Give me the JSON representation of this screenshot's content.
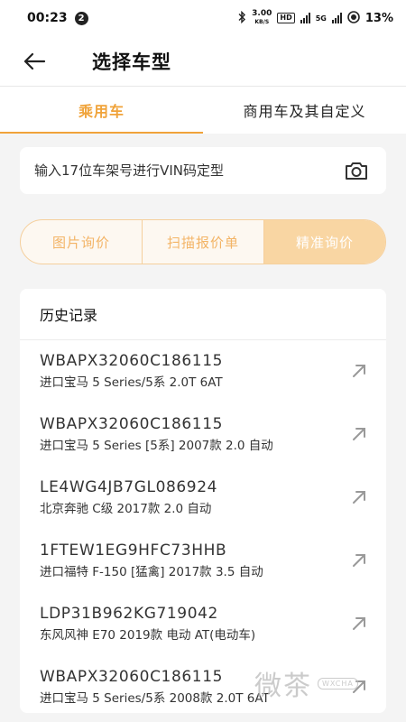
{
  "status_bar": {
    "time": "00:23",
    "notification_count": "2",
    "net_speed_value": "3.00",
    "net_speed_unit": "KB/S",
    "hd_label": "HD",
    "network_label": "5G",
    "battery_percent": "13%"
  },
  "header": {
    "title": "选择车型"
  },
  "tabs": [
    {
      "label": "乘用车",
      "active": true
    },
    {
      "label": "商用车及其自定义",
      "active": false
    }
  ],
  "vin_search": {
    "placeholder": "输入17位车架号进行VIN码定型",
    "value": ""
  },
  "modes": [
    {
      "label": "图片询价",
      "active": false
    },
    {
      "label": "扫描报价单",
      "active": false
    },
    {
      "label": "精准询价",
      "active": true
    }
  ],
  "history": {
    "title": "历史记录",
    "items": [
      {
        "vin": "WBAPX32060C186115",
        "model": "进口宝马 5 Series/5系 2.0T 6AT"
      },
      {
        "vin": "WBAPX32060C186115",
        "model": "进口宝马 5 Series [5系] 2007款 2.0 自动"
      },
      {
        "vin": "LE4WG4JB7GL086924",
        "model": "北京奔驰 C级 2017款 2.0 自动"
      },
      {
        "vin": "1FTEW1EG9HFC73HHB",
        "model": "进口福特 F-150 [猛禽] 2017款 3.5 自动"
      },
      {
        "vin": "LDP31B962KG719042",
        "model": "东风风神 E70 2019款 电动 AT(电动车)"
      },
      {
        "vin": "WBAPX32060C186115",
        "model": "进口宝马 5 Series/5系 2008款 2.0T 6AT"
      }
    ]
  },
  "watermark": {
    "text": "微茶",
    "badge": "WXCHA"
  },
  "colors": {
    "accent": "#f0a33a",
    "segment_active_bg": "#f9d6a3",
    "segment_border": "#f5cf9c"
  }
}
